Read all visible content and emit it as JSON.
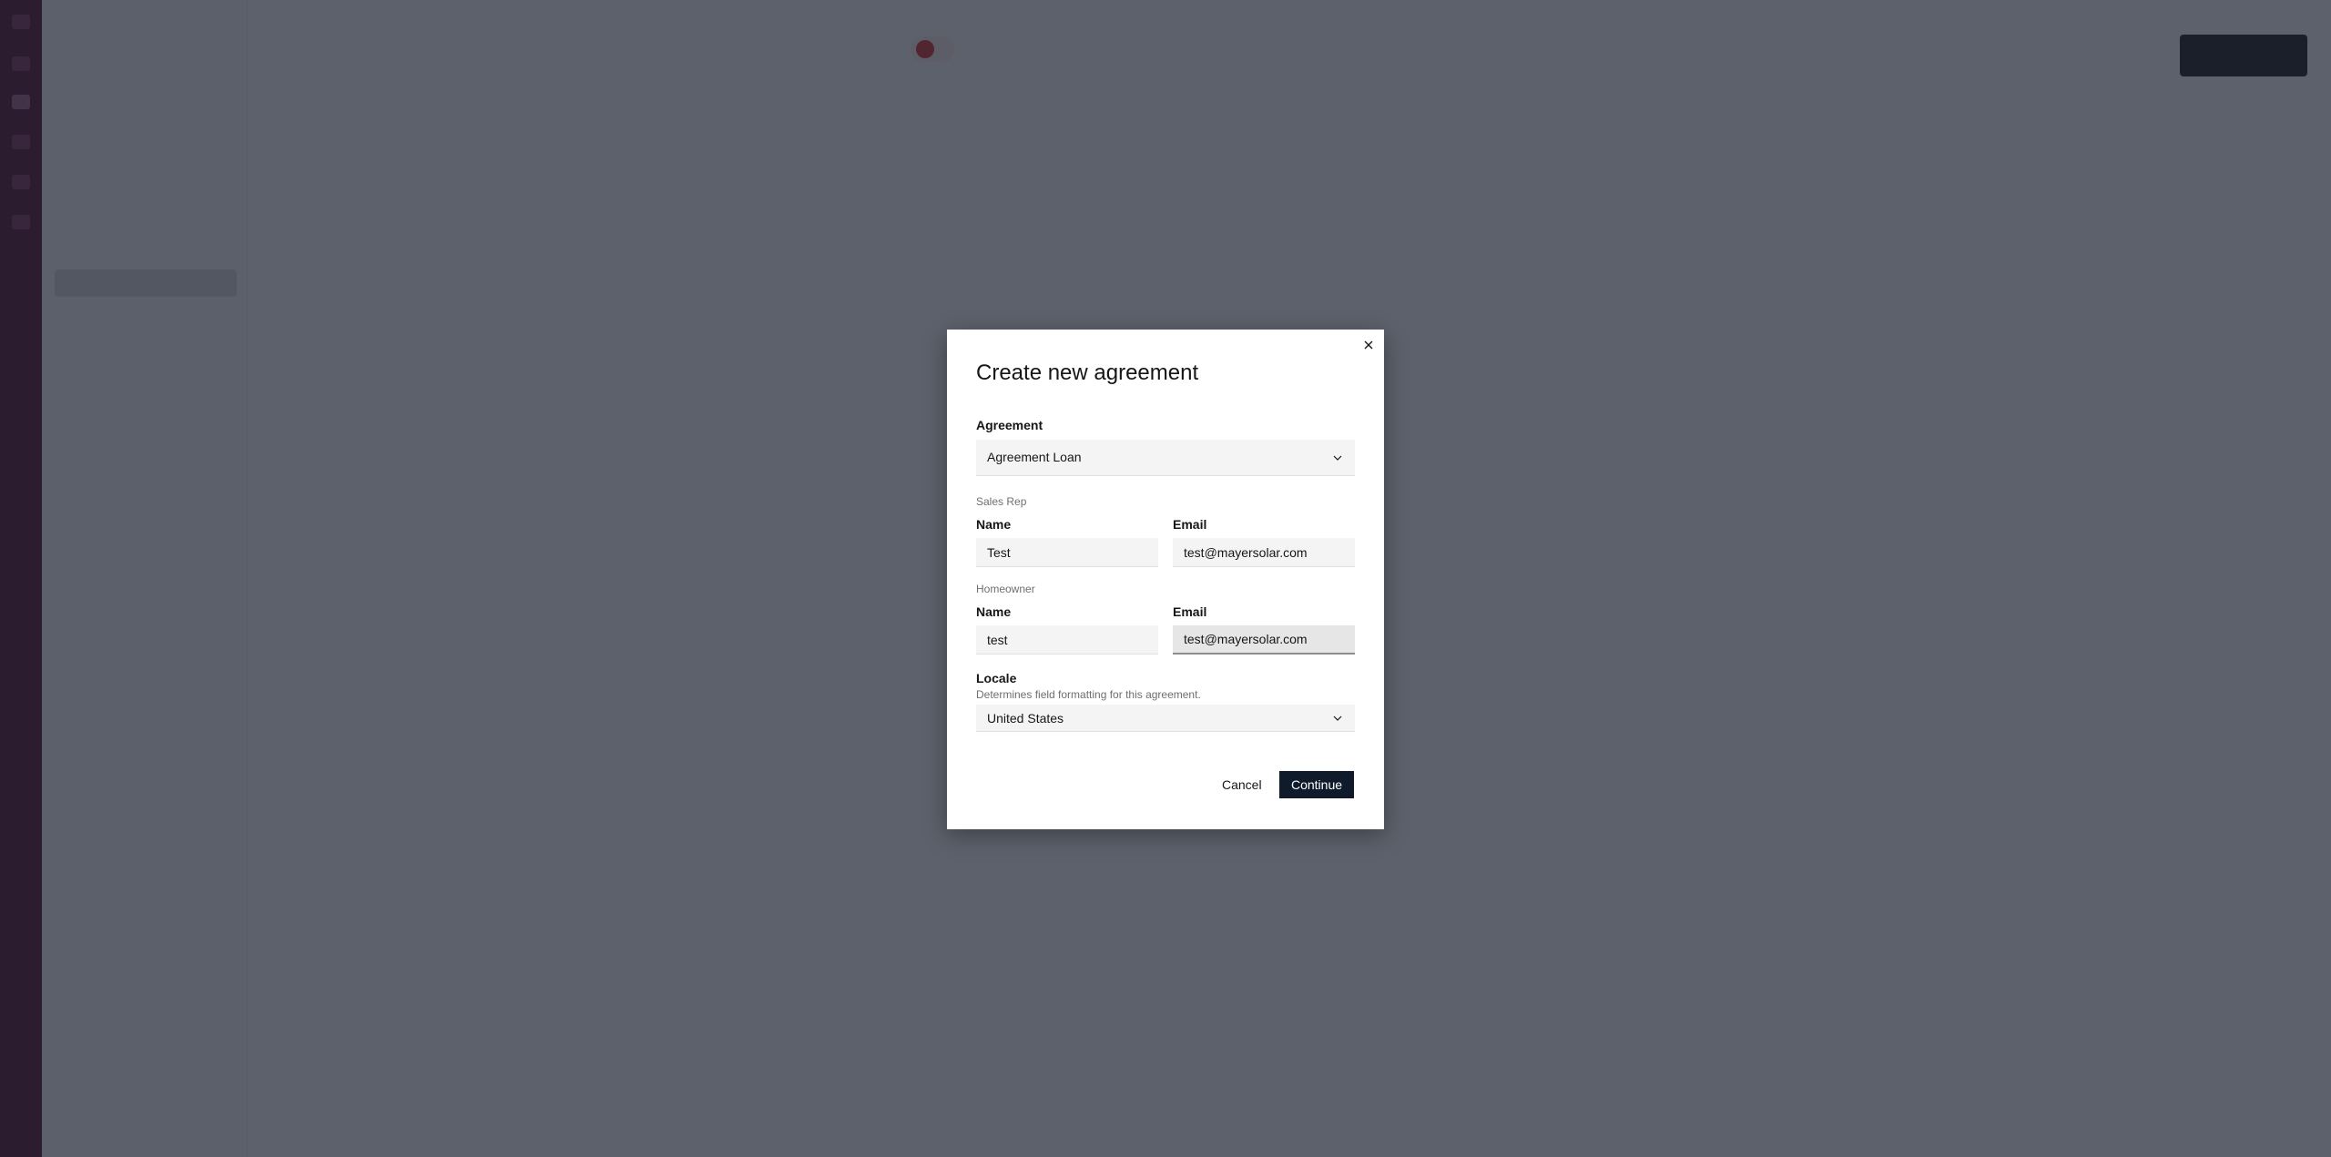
{
  "modal": {
    "title": "Create new agreement",
    "agreement": {
      "label": "Agreement",
      "selected": "Agreement Loan"
    },
    "sales_rep": {
      "section_label": "Sales Rep",
      "name_label": "Name",
      "name_value": "Test",
      "email_label": "Email",
      "email_value": "test@mayersolar.com"
    },
    "homeowner": {
      "section_label": "Homeowner",
      "name_label": "Name",
      "name_value": "test",
      "email_label": "Email",
      "email_value": "test@mayersolar.com"
    },
    "locale": {
      "label": "Locale",
      "helper": "Determines field formatting for this agreement.",
      "selected": "United States"
    },
    "cancel_label": "Cancel",
    "continue_label": "Continue"
  },
  "colors": {
    "rail": "#4d0a2c",
    "primary_button": "#0f1b2b",
    "status_red": "#d42e2e",
    "overlay": "#5d616c"
  },
  "icons": [
    "close-icon",
    "chevron-down-icon"
  ]
}
